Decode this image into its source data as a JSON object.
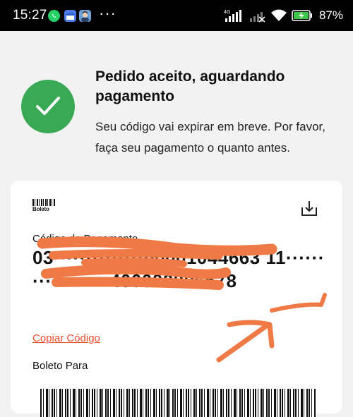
{
  "status_bar": {
    "time": "15:27",
    "more": "···",
    "network_label": "4G",
    "battery_percent": "87%",
    "icons": [
      "whatsapp-icon",
      "calendar-icon",
      "avatar-icon",
      "signal-icon",
      "wifi-icon",
      "battery-icon"
    ]
  },
  "header": {
    "title": "Pedido aceito, aguardando pagamento",
    "subtitle": "Seu código vai expirar em breve. Por favor, faça seu pagamento o quanto antes."
  },
  "card": {
    "logo_text": "Boleto",
    "code_label": "Código de Pagamento",
    "code_value": "03··············00001044663 11··················400000006578",
    "copy_label": "Copiar Código",
    "boleto_para_label": "Boleto Para"
  },
  "colors": {
    "success": "#3aa956",
    "link": "#ee4d2d",
    "annotation": "#f07a45"
  }
}
